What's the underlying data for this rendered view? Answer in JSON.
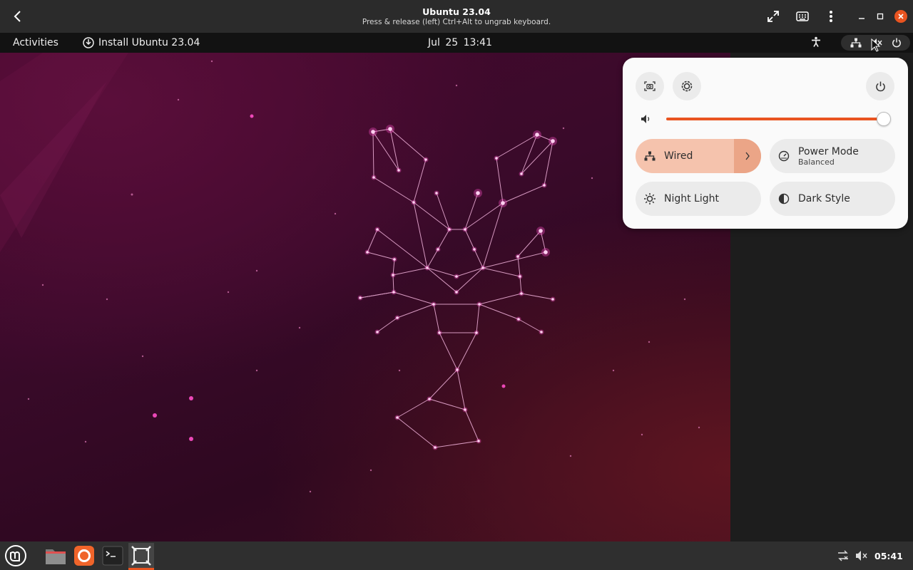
{
  "vm": {
    "title": "Ubuntu 23.04",
    "subtitle": "Press & release (left) Ctrl+Alt to ungrab keyboard."
  },
  "topbar": {
    "activities": "Activities",
    "install_label": "Install Ubuntu 23.04",
    "date": "Jul 25",
    "time": "13:41"
  },
  "quick_settings": {
    "volume_percent": 100,
    "tiles": {
      "wired": {
        "label": "Wired",
        "active": true
      },
      "power_mode": {
        "label": "Power Mode",
        "subtitle": "Balanced"
      },
      "night_light": {
        "label": "Night Light"
      },
      "dark_style": {
        "label": "Dark Style"
      }
    }
  },
  "taskbar": {
    "clock": "05:41",
    "items": [
      "mint-menu-icon",
      "files-icon",
      "firefox-icon",
      "terminal-icon",
      "vm-app-icon"
    ]
  },
  "colors": {
    "accent": "#e95420",
    "wallpaper": "#3a0a2a",
    "star": "#ff4fc8"
  }
}
